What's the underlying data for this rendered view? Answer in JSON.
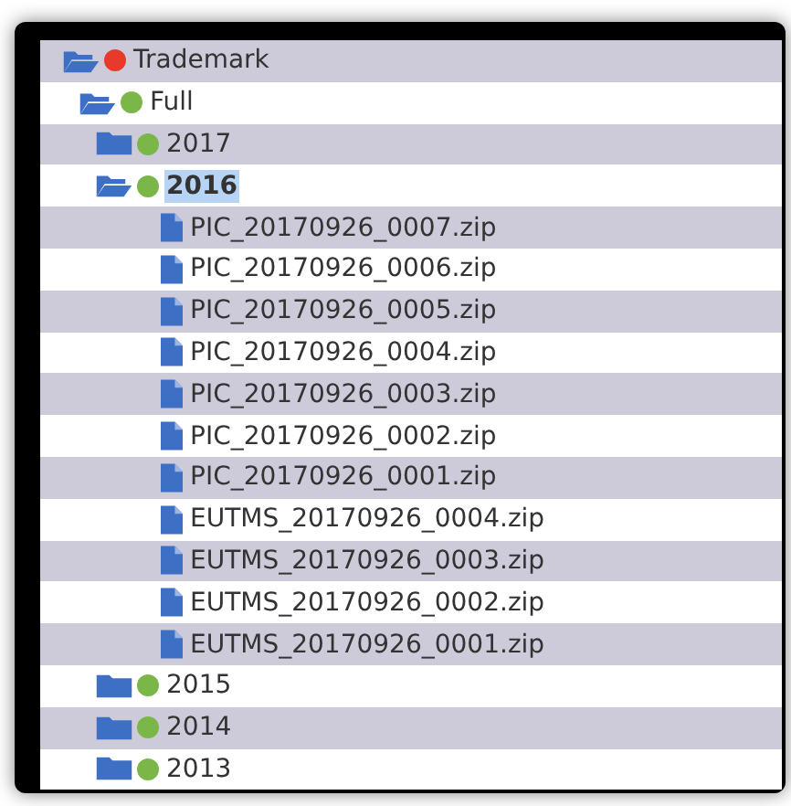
{
  "tree": [
    {
      "kind": "folder",
      "label": "Trademark",
      "color": "#e8392b",
      "expanded": true,
      "selected": false,
      "children": [
        {
          "kind": "folder",
          "label": "Full",
          "color": "#7ab648",
          "expanded": true,
          "selected": false,
          "children": [
            {
              "kind": "folder",
              "label": "2017",
              "color": "#7ab648",
              "expanded": false,
              "selected": false
            },
            {
              "kind": "folder",
              "label": "2016",
              "color": "#7ab648",
              "expanded": true,
              "selected": true,
              "children": [
                {
                  "kind": "file",
                  "label": "PIC_20170926_0007.zip",
                  "selected": false
                },
                {
                  "kind": "file",
                  "label": "PIC_20170926_0006.zip",
                  "selected": false
                },
                {
                  "kind": "file",
                  "label": "PIC_20170926_0005.zip",
                  "selected": false
                },
                {
                  "kind": "file",
                  "label": "PIC_20170926_0004.zip",
                  "selected": false
                },
                {
                  "kind": "file",
                  "label": "PIC_20170926_0003.zip",
                  "selected": false
                },
                {
                  "kind": "file",
                  "label": "PIC_20170926_0002.zip",
                  "selected": false
                },
                {
                  "kind": "file",
                  "label": "PIC_20170926_0001.zip",
                  "selected": false
                },
                {
                  "kind": "file",
                  "label": "EUTMS_20170926_0004.zip",
                  "selected": false
                },
                {
                  "kind": "file",
                  "label": "EUTMS_20170926_0003.zip",
                  "selected": false
                },
                {
                  "kind": "file",
                  "label": "EUTMS_20170926_0002.zip",
                  "selected": false
                },
                {
                  "kind": "file",
                  "label": "EUTMS_20170926_0001.zip",
                  "selected": false
                }
              ]
            },
            {
              "kind": "folder",
              "label": "2015",
              "color": "#7ab648",
              "expanded": false,
              "selected": false
            },
            {
              "kind": "folder",
              "label": "2014",
              "color": "#7ab648",
              "expanded": false,
              "selected": false
            },
            {
              "kind": "folder",
              "label": "2013",
              "color": "#7ab648",
              "expanded": false,
              "selected": false
            }
          ]
        }
      ]
    }
  ]
}
